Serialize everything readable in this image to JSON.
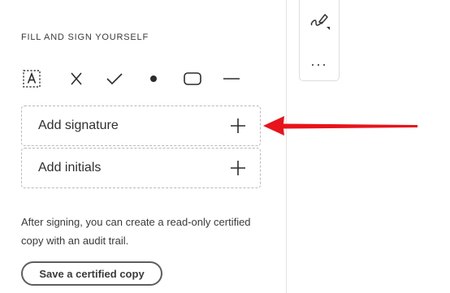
{
  "fill_sign": {
    "heading": "FILL AND SIGN YOURSELF",
    "tools": [
      {
        "icon": "text-field-icon"
      },
      {
        "icon": "cross-mark-icon"
      },
      {
        "icon": "checkmark-icon"
      },
      {
        "icon": "dot-icon"
      },
      {
        "icon": "rounded-rectangle-icon"
      },
      {
        "icon": "line-icon"
      }
    ],
    "add_signature_label": "Add signature",
    "add_initials_label": "Add initials",
    "info_text": "After signing, you can create a read-only certified copy with an audit trail.",
    "certified_copy_button": "Save a certified copy"
  },
  "side_toolbar": {
    "items": [
      {
        "icon": "pen-sign-icon"
      },
      {
        "icon": "more-options-icon",
        "label": "..."
      }
    ]
  },
  "colors": {
    "annotation_arrow": "#e8131b",
    "dashed_border": "#b9b9b9",
    "text": "#2c2c2c"
  }
}
